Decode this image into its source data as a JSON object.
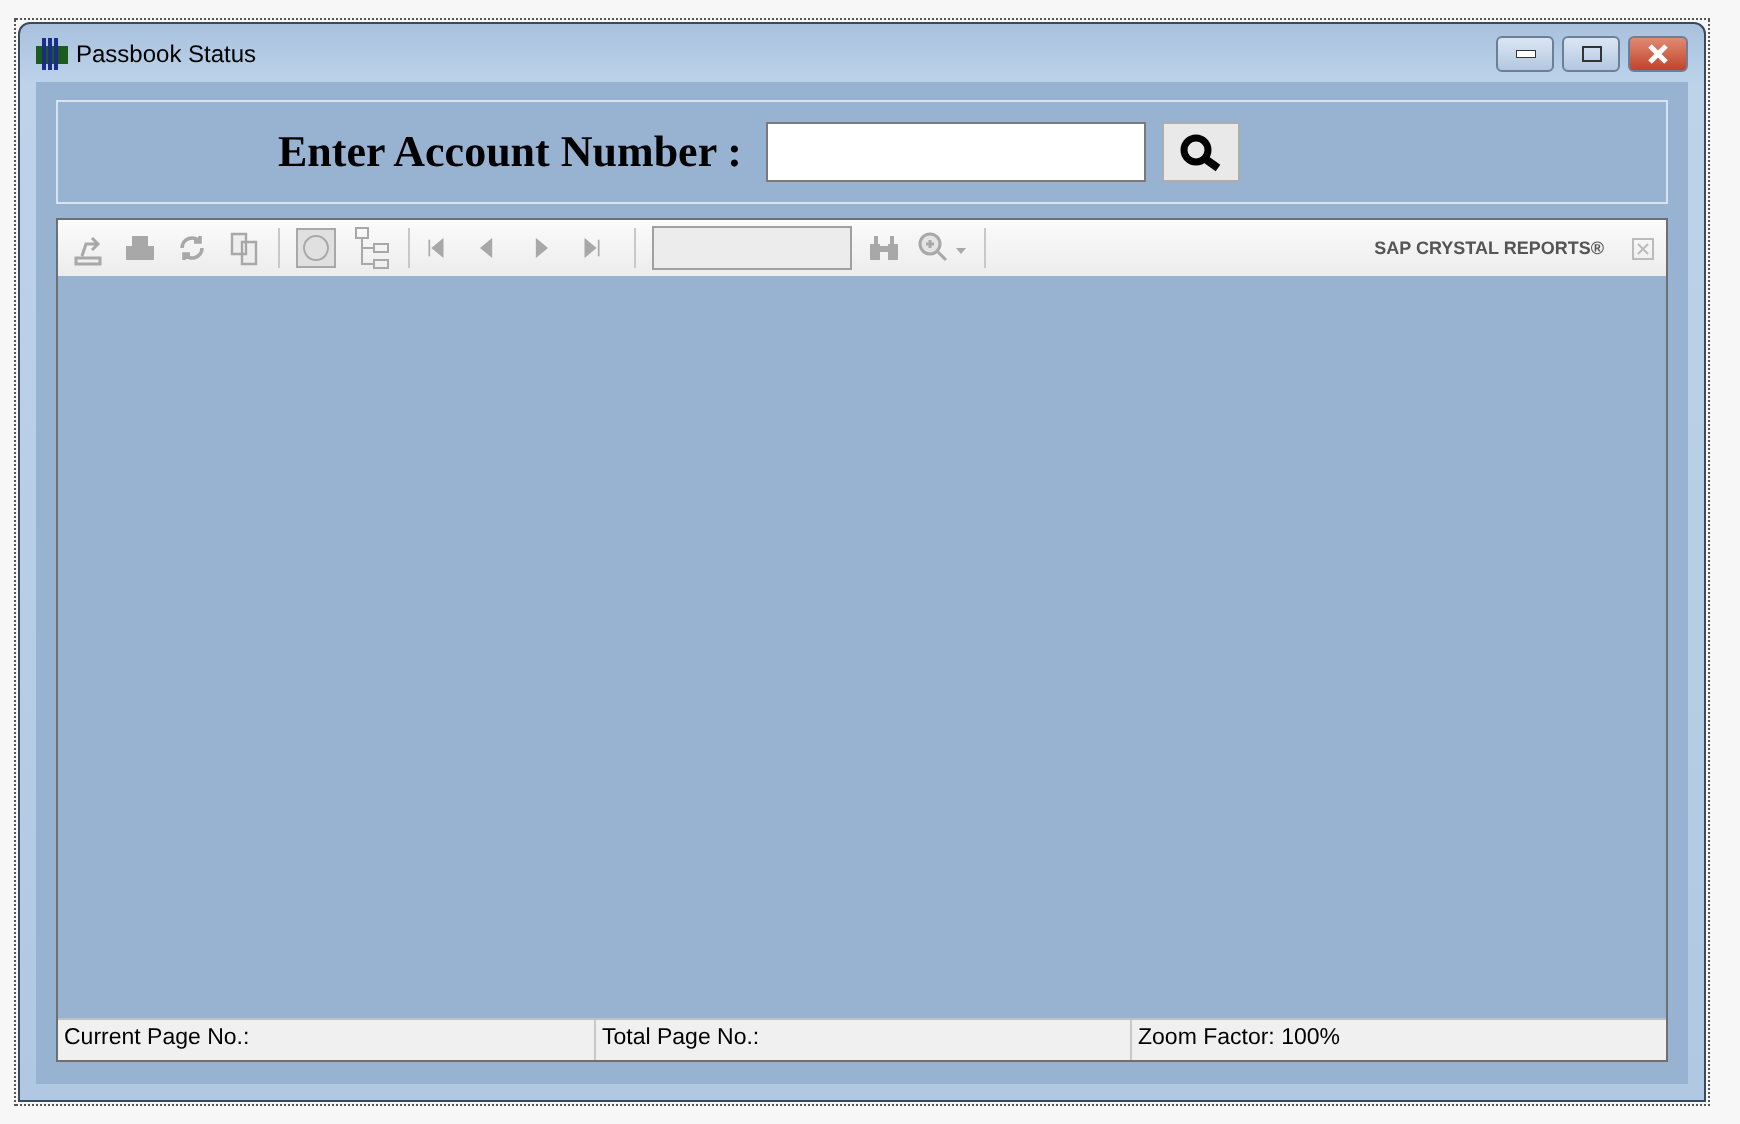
{
  "window": {
    "title": "Passbook Status"
  },
  "search": {
    "label": "Enter Account Number :"
  },
  "viewer": {
    "brand": "SAP CRYSTAL REPORTS®"
  },
  "status_bar": [
    "Current Page No.:",
    "Total Page No.:",
    "Zoom Factor: 100%"
  ]
}
